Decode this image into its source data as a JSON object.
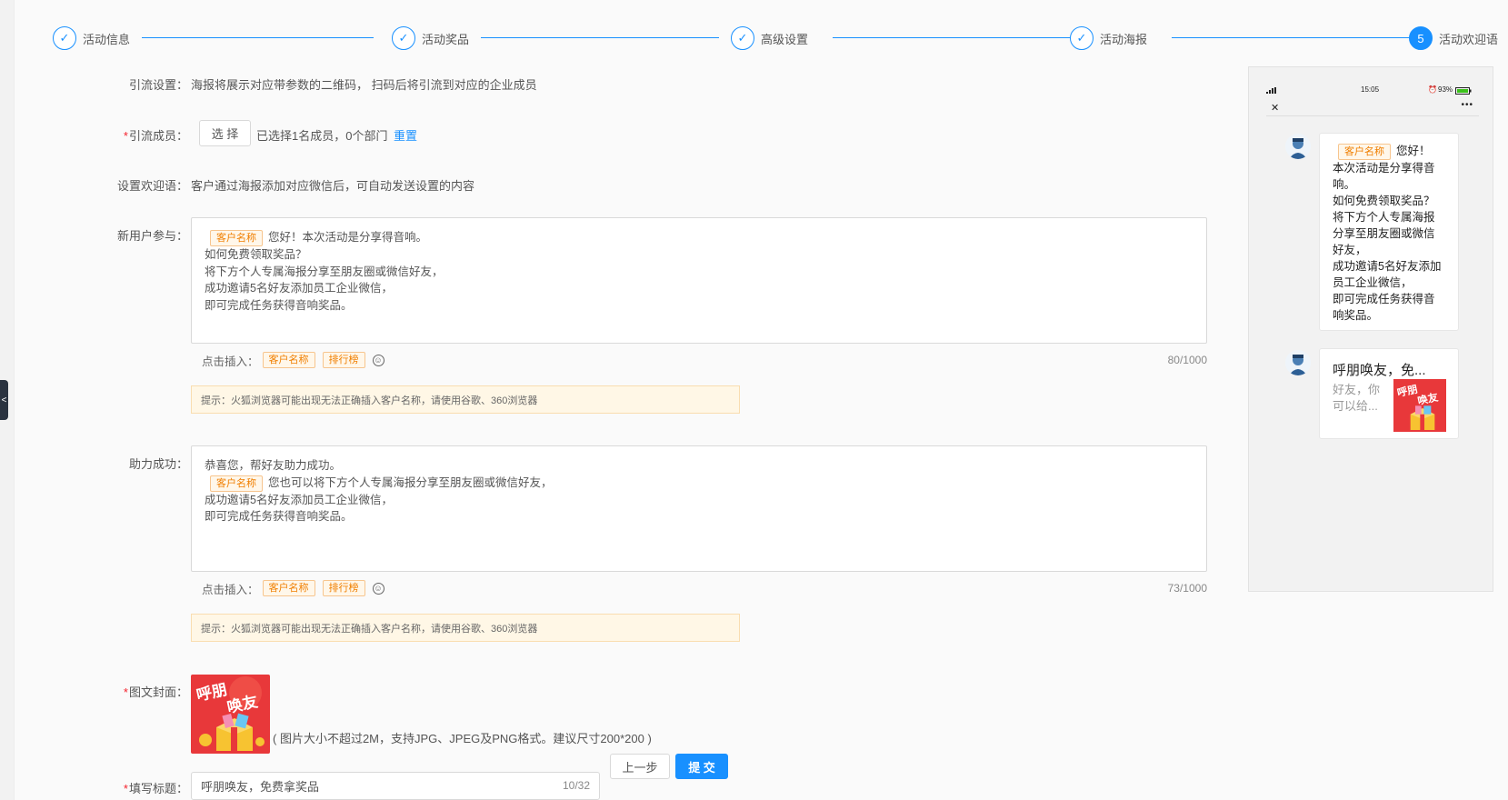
{
  "steps": [
    {
      "label": "活动信息",
      "state": "done"
    },
    {
      "label": "活动奖品",
      "state": "done"
    },
    {
      "label": "高级设置",
      "state": "done"
    },
    {
      "label": "活动海报",
      "state": "done"
    },
    {
      "label": "活动欢迎语",
      "state": "active",
      "number": "5"
    }
  ],
  "form": {
    "traffic_label": "引流设置：",
    "traffic_desc": "海报将展示对应带参数的二维码， 扫码后将引流到对应的企业成员",
    "members_label": "引流成员：",
    "select_button": "选 择",
    "members_summary": "已选择1名成员，0个部门",
    "reset_link": "重置",
    "welcome_label": "设置欢迎语：",
    "welcome_desc": "客户通过海报添加对应微信后，可自动发送设置的内容",
    "new_user_label": "新用户参与：",
    "new_user": {
      "tag": "客户名称",
      "line1_after_tag": "您好！本次活动是分享得音响。",
      "line2": "如何免费领取奖品？",
      "line3": "将下方个人专属海报分享至朋友圈或微信好友，",
      "line4": "成功邀请5名好友添加员工企业微信，",
      "line5": "即可完成任务获得音响奖品。",
      "counter": "80/1000"
    },
    "insert_label": "点击插入：",
    "insert_tag_name": "客户名称",
    "insert_tag_rank": "排行榜",
    "smiley_glyph": "☺",
    "hint": "提示：火狐浏览器可能出现无法正确插入客户名称，请使用谷歌、360浏览器",
    "assist_label": "助力成功：",
    "assist": {
      "line1": "恭喜您，帮好友助力成功。",
      "tag": "客户名称",
      "line2_after_tag": "您也可以将下方个人专属海报分享至朋友圈或微信好友，",
      "line3": "成功邀请5名好友添加员工企业微信，",
      "line4": "即可完成任务获得音响奖品。",
      "counter": "73/1000"
    },
    "cover_label": "图文封面：",
    "cover_hint": "( 图片大小不超过2M，支持JPG、JPEG及PNG格式。建议尺寸200*200 )",
    "title_label": "填写标题：",
    "title_value": "呼朋唤友，免费拿奖品",
    "title_counter": "10/32",
    "prev_button": "上一步",
    "submit_button": "提 交"
  },
  "preview": {
    "status_time": "15:05",
    "status_battery": "93%",
    "close_glyph": "✕",
    "more_glyph": "•••",
    "bubble1": {
      "tag": "客户名称",
      "first": "您好！",
      "lines": [
        "本次活动是分享得音",
        "响。",
        "如何免费领取奖品？",
        "将下方个人专属海报",
        "分享至朋友圈或微信",
        "好友，",
        "成功邀请5名好友添加",
        "员工企业微信，",
        "即可完成任务获得音",
        "响奖品。"
      ]
    },
    "card": {
      "title": "呼朋唤友，免...",
      "desc1": "好友，你",
      "desc2": "可以给..."
    }
  },
  "collapse_glyph": "<",
  "colors": {
    "primary": "#1890ff",
    "tag_orange": "#f07f00",
    "required": "#f5222d"
  }
}
